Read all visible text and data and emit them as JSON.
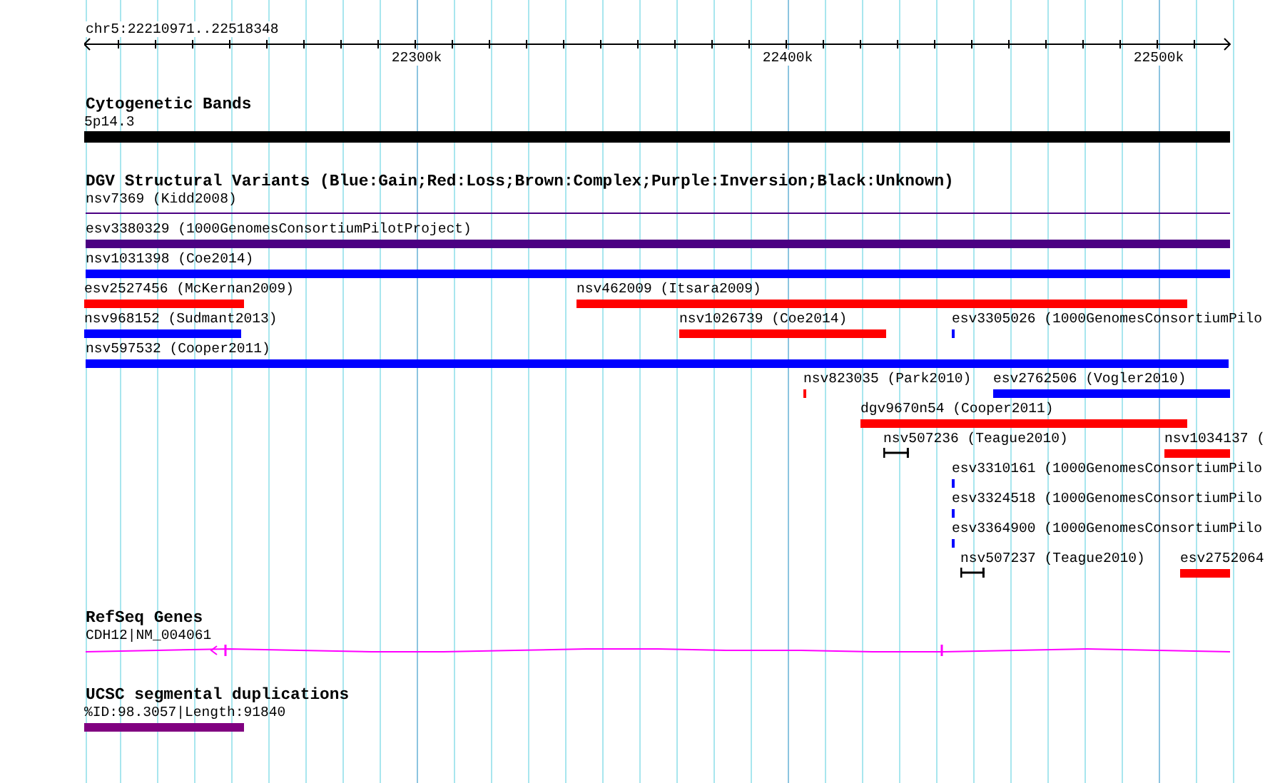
{
  "ruler": {
    "location": "chr5:22210971..22518348",
    "ticks": [
      "22300k",
      "22400k",
      "22500k"
    ]
  },
  "tracks": [
    {
      "title": "Cytogenetic Bands",
      "rows": [
        [
          {
            "label": "5p14.3",
            "kind": "band",
            "color": "#000000"
          }
        ]
      ]
    },
    {
      "title": "DGV Structural Variants (Blue:Gain;Red:Loss;Brown:Complex;Purple:Inversion;Black:Unknown)",
      "rows": [
        [
          {
            "label": "nsv7369 (Kidd2008)",
            "kind": "line",
            "color": "#4b0082"
          }
        ],
        [
          {
            "label": "esv3380329 (1000GenomesConsortiumPilotProject)",
            "kind": "bar",
            "color": "#4b0082"
          }
        ],
        [
          {
            "label": "nsv1031398 (Coe2014)",
            "kind": "bar",
            "color": "#0000ff"
          }
        ],
        [
          {
            "label": "esv2527456 (McKernan2009)",
            "kind": "bar",
            "color": "#ff0000"
          },
          {
            "label": "nsv462009 (Itsara2009)",
            "kind": "bar",
            "color": "#ff0000"
          }
        ],
        [
          {
            "label": "nsv968152 (Sudmant2013)",
            "kind": "bar",
            "color": "#0000ff"
          },
          {
            "label": "nsv1026739 (Coe2014)",
            "kind": "bar",
            "color": "#ff0000"
          },
          {
            "label": "esv3305026 (1000GenomesConsortiumPilo",
            "kind": "bar",
            "color": "#0000ff"
          }
        ],
        [
          {
            "label": "nsv597532 (Cooper2011)",
            "kind": "bar",
            "color": "#0000ff"
          }
        ],
        [
          {
            "label": "nsv823035 (Park2010)",
            "kind": "bar",
            "color": "#ff0000"
          },
          {
            "label": "esv2762506 (Vogler2010)",
            "kind": "bar",
            "color": "#0000ff"
          }
        ],
        [
          {
            "label": "dgv9670n54 (Cooper2011)",
            "kind": "bar",
            "color": "#ff0000"
          }
        ],
        [
          {
            "label": "nsv507236 (Teague2010)",
            "kind": "interval",
            "color": "#000000"
          },
          {
            "label": "nsv1034137 (",
            "kind": "bar",
            "color": "#ff0000"
          }
        ],
        [
          {
            "label": "esv3310161 (1000GenomesConsortiumPilo",
            "kind": "bar",
            "color": "#0000ff"
          }
        ],
        [
          {
            "label": "esv3324518 (1000GenomesConsortiumPilo",
            "kind": "bar",
            "color": "#0000ff"
          }
        ],
        [
          {
            "label": "esv3364900 (1000GenomesConsortiumPilo",
            "kind": "bar",
            "color": "#0000ff"
          }
        ],
        [
          {
            "label": "nsv507237 (Teague2010)",
            "kind": "interval",
            "color": "#000000"
          },
          {
            "label": "esv2752064",
            "kind": "bar",
            "color": "#ff0000"
          }
        ]
      ]
    },
    {
      "title": "RefSeq Genes",
      "rows": [
        [
          {
            "label": "CDH12|NM_004061",
            "kind": "gene",
            "color": "#ff00ff"
          }
        ]
      ]
    },
    {
      "title": "UCSC segmental duplications",
      "rows": [
        [
          {
            "label": "%ID:98.3057|Length:91840",
            "kind": "bar",
            "color": "#800080"
          }
        ]
      ]
    }
  ]
}
